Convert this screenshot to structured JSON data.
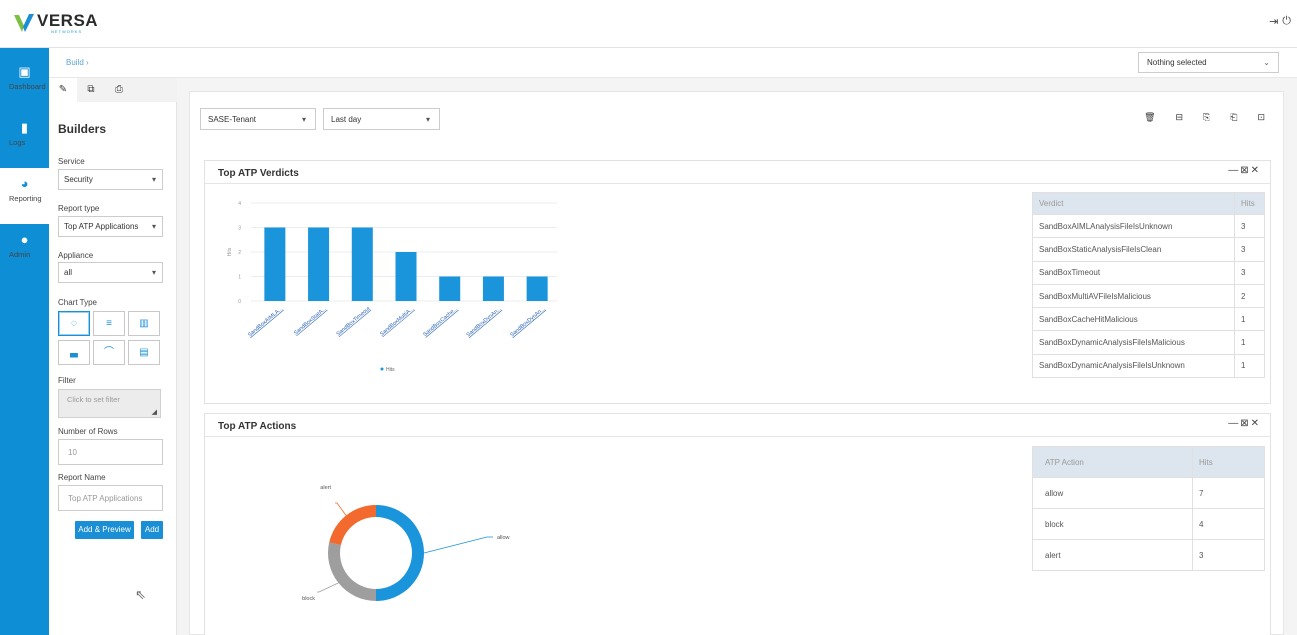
{
  "app": {
    "brand_name": "VERSA",
    "brand_sub": "NETWORKS",
    "logout_icon": "logout-icon",
    "power_icon": "power-icon"
  },
  "nav": [
    {
      "label": "Dashboard",
      "icon": "dashboard-icon",
      "glyph": "▣"
    },
    {
      "label": "Logs",
      "icon": "logs-icon",
      "glyph": "▮"
    },
    {
      "label": "Reporting",
      "icon": "reporting-icon",
      "glyph": "◕"
    },
    {
      "label": "Admin",
      "icon": "admin-icon",
      "glyph": "●"
    }
  ],
  "breadcrumb": "Build",
  "top_select": "Nothing selected",
  "builders": {
    "title": "Builders",
    "service_label": "Service",
    "service_value": "Security",
    "report_type_label": "Report type",
    "report_type_value": "Top ATP Applications",
    "appliance_label": "Appliance",
    "appliance_value": "all",
    "chart_type_label": "Chart Type",
    "filter_label": "Filter",
    "filter_placeholder": "Click to set filter",
    "rows_label": "Number of Rows",
    "rows_placeholder": "10",
    "report_name_label": "Report Name",
    "report_name_placeholder": "Top ATP Applications",
    "add_preview_label": "Add & Preview",
    "add_label": "Add"
  },
  "filters": {
    "tenant": "SASE-Tenant",
    "range": "Last day"
  },
  "verdicts": {
    "title": "Top ATP Verdicts",
    "controls": "— ⊠ ✕",
    "col_verdict": "Verdict",
    "col_hits": "Hits",
    "rows": [
      {
        "verdict": "SandBoxAIMLAnalysisFileIsUnknown",
        "hits": "3"
      },
      {
        "verdict": "SandBoxStaticAnalysisFileIsClean",
        "hits": "3"
      },
      {
        "verdict": "SandBoxTimeout",
        "hits": "3"
      },
      {
        "verdict": "SandBoxMultiAVFileIsMalicious",
        "hits": "2"
      },
      {
        "verdict": "SandBoxCacheHitMalicious",
        "hits": "1"
      },
      {
        "verdict": "SandBoxDynamicAnalysisFileIsMalicious",
        "hits": "1"
      },
      {
        "verdict": "SandBoxDynamicAnalysisFileIsUnknown",
        "hits": "1"
      }
    ]
  },
  "actions": {
    "title": "Top ATP Actions",
    "controls": "— ⊠ ✕",
    "col_action": "ATP Action",
    "col_hits": "Hits",
    "rows": [
      {
        "action": "allow",
        "hits": "7"
      },
      {
        "action": "block",
        "hits": "4"
      },
      {
        "action": "alert",
        "hits": "3"
      }
    ]
  },
  "chart_data": [
    {
      "type": "bar",
      "categories": [
        "SandBoxAIMLA...",
        "SandBoxStatA...",
        "SandBoxTimeout",
        "SandBoxMultiA...",
        "SandBoxCache...",
        "SandBoxDynAn...",
        "SandBoxDynAn..."
      ],
      "series": [
        {
          "name": "Hits",
          "values": [
            3,
            3,
            3,
            2,
            1,
            1,
            1
          ]
        }
      ],
      "ylabel": "Hits",
      "ylim": [
        0,
        4
      ],
      "yticks": [
        "0",
        "1",
        "2",
        "3",
        "4"
      ],
      "color": "#1a94da",
      "legend": "bottom"
    },
    {
      "type": "pie",
      "donut": true,
      "labels": [
        "allow",
        "block",
        "alert"
      ],
      "values": [
        7,
        4,
        3
      ],
      "colors": [
        "#1a94da",
        "#9e9e9e",
        "#f26a2e"
      ]
    }
  ]
}
